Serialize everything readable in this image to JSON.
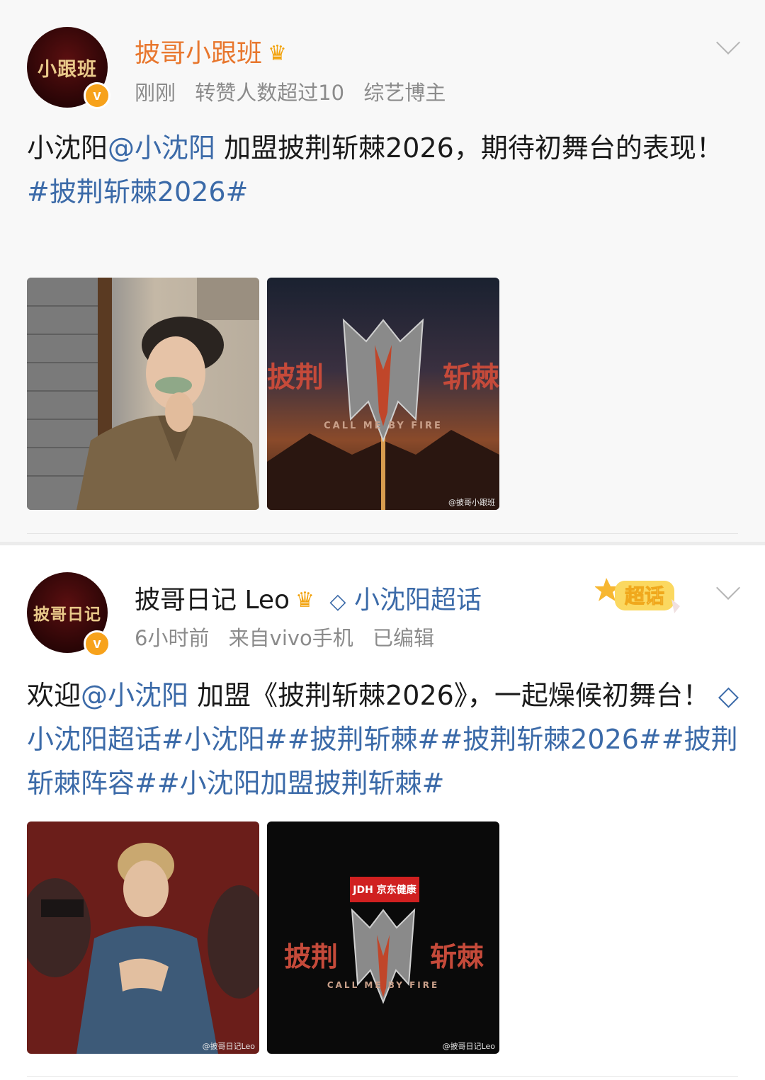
{
  "posts": [
    {
      "author": "披哥小跟班",
      "avatar_text": "小跟班",
      "meta": [
        "刚刚",
        "转赞人数超过10",
        "综艺博主"
      ],
      "text_a": "小沈阳",
      "mention": "@小沈阳",
      "text_b": " 加盟披荆斩棘2026，期待初舞台的表现！",
      "hashtag": "#披荆斩棘2026#",
      "images": [
        {
          "icon": "man-portrait-teacup"
        },
        {
          "icon": "show-poster-fire",
          "logo_title": "披荆",
          "logo_title_2": "斩棘",
          "logo_sub": "CALL ME BY FIRE",
          "watermark": "@披哥小跟班"
        }
      ]
    },
    {
      "author": "披哥日记 Leo",
      "avatar_text": "披哥日记",
      "topic": "小沈阳超话",
      "super_badge": "超话",
      "meta": [
        "6小时前",
        "来自vivo手机",
        "已编辑"
      ],
      "text_a": "欢迎",
      "mention": "@小沈阳",
      "text_b": " 加盟《披荆斩棘2026》，一起燥候初舞台！",
      "topic_link": "小沈阳超话",
      "hashtags": "#小沈阳##披荆斩棘##披荆斩棘2026##披荆斩棘阵容##小沈阳加盟披荆斩棘#",
      "images": [
        {
          "icon": "man-portrait-denim",
          "watermark": "@披哥日记Leo"
        },
        {
          "icon": "show-poster-dark",
          "sponsor": "JDH 京东健康",
          "logo_title": "披荆",
          "logo_title_2": "斩棘",
          "logo_sub": "CALL ME BY FIRE",
          "watermark": "@披哥日记Leo"
        }
      ]
    }
  ],
  "colors": {
    "link": "#3b6aa8",
    "vip_name": "#e8772e",
    "meta": "#8b8b8b",
    "badge": "#f7a21b"
  }
}
